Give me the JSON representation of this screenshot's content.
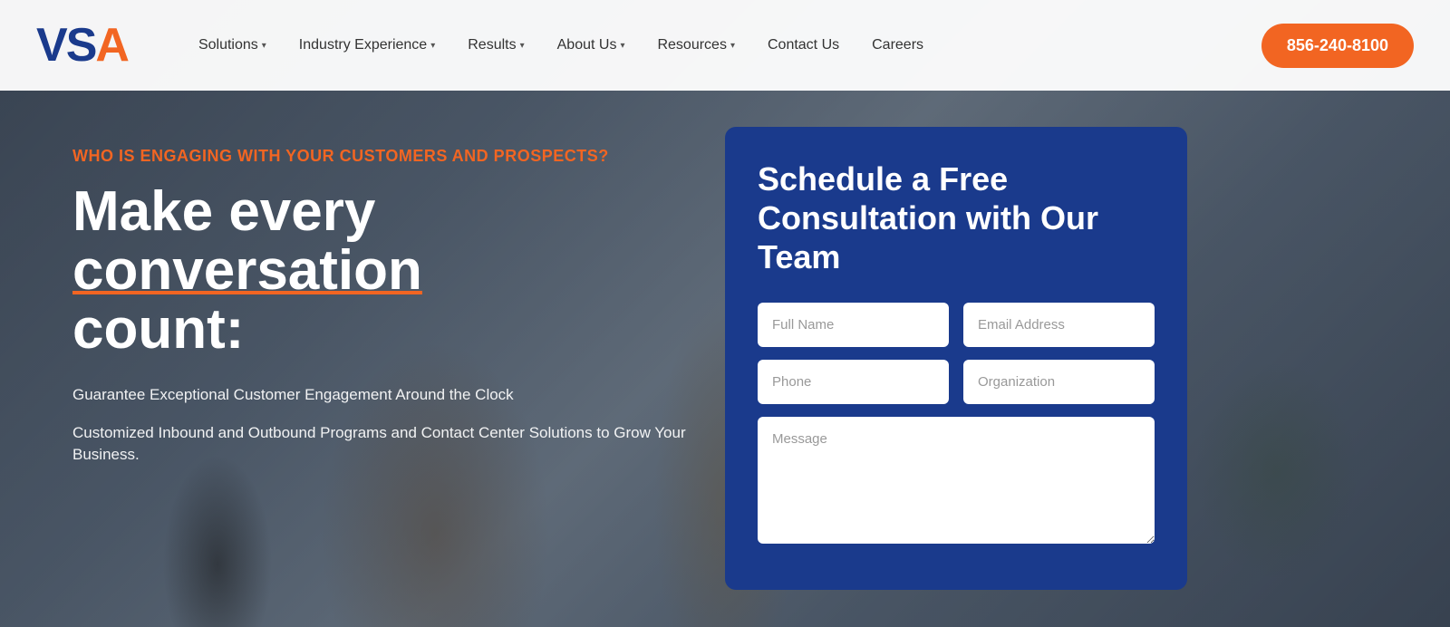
{
  "header": {
    "logo": {
      "v": "V",
      "s": "S",
      "a": "A"
    },
    "nav": [
      {
        "label": "Solutions",
        "hasDropdown": true
      },
      {
        "label": "Industry Experience",
        "hasDropdown": true
      },
      {
        "label": "Results",
        "hasDropdown": true
      },
      {
        "label": "About Us",
        "hasDropdown": true
      },
      {
        "label": "Resources",
        "hasDropdown": true
      },
      {
        "label": "Contact Us",
        "hasDropdown": false
      },
      {
        "label": "Careers",
        "hasDropdown": false
      }
    ],
    "phone": "856-240-8100"
  },
  "hero": {
    "eyebrow": "WHO IS ENGAGING WITH YOUR CUSTOMERS AND PROSPECTS?",
    "headline_line1": "Make every",
    "headline_line2": "conversation",
    "headline_line3": "count:",
    "bullets": [
      "Guarantee Exceptional Customer Engagement Around the Clock",
      "Customized Inbound and Outbound Programs and Contact Center Solutions to Grow Your Business."
    ]
  },
  "form": {
    "title": "Schedule a Free Consultation with Our Team",
    "fields": {
      "full_name": {
        "placeholder": "Full Name"
      },
      "email": {
        "placeholder": "Email Address"
      },
      "phone": {
        "placeholder": "Phone"
      },
      "organization": {
        "placeholder": "Organization"
      },
      "message": {
        "placeholder": "Message"
      }
    }
  },
  "colors": {
    "accent_orange": "#f26522",
    "brand_blue": "#1a3a8c"
  }
}
